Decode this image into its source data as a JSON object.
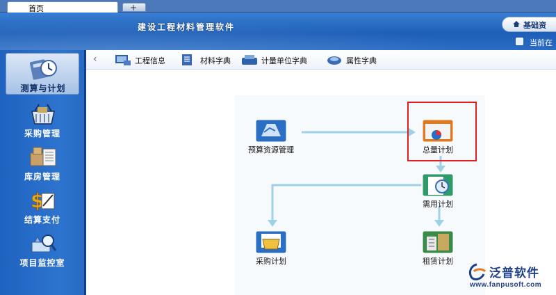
{
  "tabs": {
    "home_label": "首页",
    "add_label": "+"
  },
  "header": {
    "title": "建设工程材料管理软件",
    "basic_button": "基础资",
    "current_location": "当前在"
  },
  "sidebar": {
    "items": [
      {
        "label": "测算与计划",
        "icon": "calculator-clock-icon",
        "active": true
      },
      {
        "label": "采购管理",
        "icon": "shopping-basket-icon",
        "active": false
      },
      {
        "label": "库房管理",
        "icon": "warehouse-boxes-icon",
        "active": false
      },
      {
        "label": "结算支付",
        "icon": "dollar-settlement-icon",
        "active": false
      },
      {
        "label": "项目监控室",
        "icon": "monitor-magnifier-icon",
        "active": false
      }
    ]
  },
  "toolbar": {
    "back": "‹",
    "items": [
      {
        "label": "工程信息",
        "icon": "project-info-icon"
      },
      {
        "label": "材料字典",
        "icon": "material-dictionary-icon"
      },
      {
        "label": "计量单位字典",
        "icon": "unit-dictionary-icon"
      },
      {
        "label": "属性字典",
        "icon": "attribute-dictionary-icon"
      }
    ]
  },
  "flow": {
    "nodes": {
      "budget": {
        "label": "预算资源管理",
        "icon": "folder-document-icon"
      },
      "total_plan": {
        "label": "总量计划",
        "icon": "pie-chart-folder-icon",
        "highlighted": true
      },
      "demand_plan": {
        "label": "需用计划",
        "icon": "clock-document-icon"
      },
      "purchase_plan": {
        "label": "采购计划",
        "icon": "cart-document-icon"
      },
      "lease_plan": {
        "label": "租赁计划",
        "icon": "building-document-icon"
      }
    }
  },
  "logo": {
    "brand": "泛普软件",
    "url": "www.fanpusoft.com"
  },
  "colors": {
    "sidebar": "#2768c2",
    "highlight": "#e02020",
    "arrow": "#9fd0e6"
  }
}
